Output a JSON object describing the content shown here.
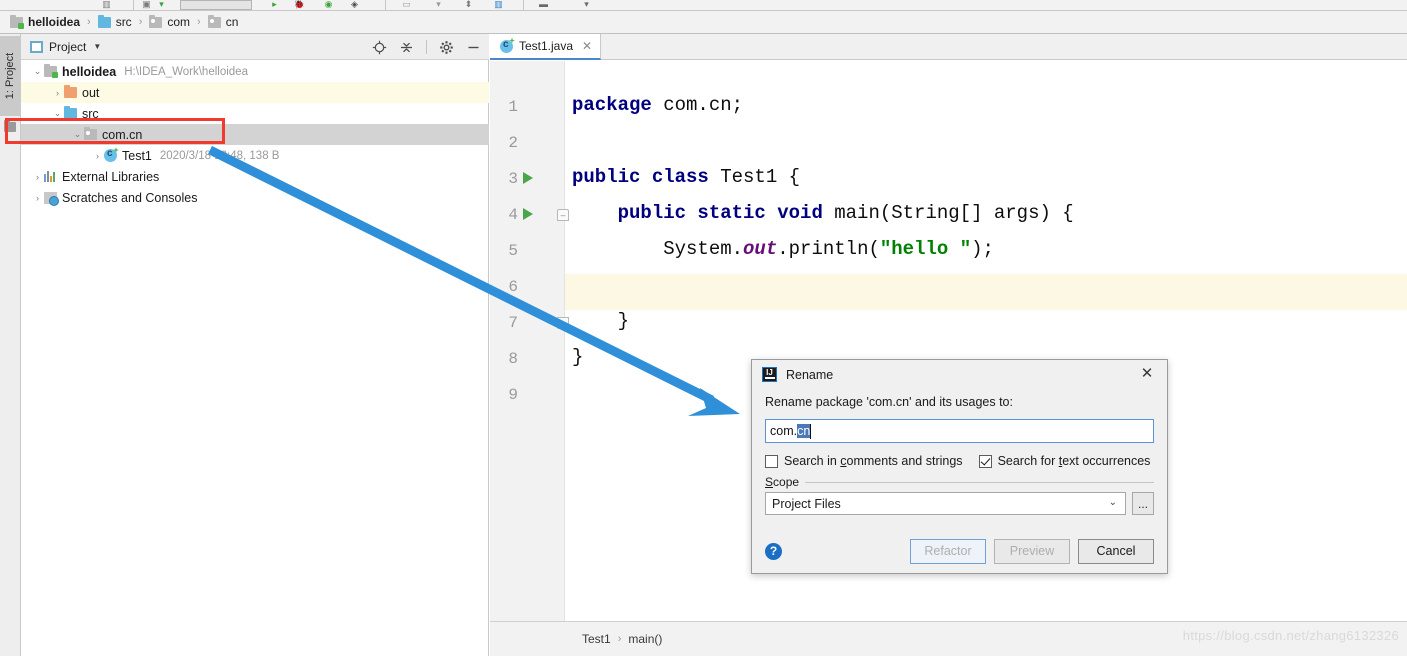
{
  "toolbar": {
    "icons": [
      "chart-icon",
      "build-icon",
      "run-config-box",
      "run-icon",
      "debug-icon",
      "coverage-icon",
      "profile-icon",
      "search-box-icon",
      "filter-icon",
      "pin-icon",
      "layout-icon",
      "minus-icon",
      "dropdown-icon"
    ]
  },
  "breadcrumb": {
    "items": [
      {
        "label": "helloidea",
        "icon": "module-folder-icon",
        "bold": true
      },
      {
        "label": "src",
        "icon": "source-folder-icon",
        "bold": false
      },
      {
        "label": "com",
        "icon": "package-folder-icon",
        "bold": false
      },
      {
        "label": "cn",
        "icon": "package-folder-icon",
        "bold": false
      }
    ],
    "separator": "›"
  },
  "tool_window_tab": {
    "label": "1: Project"
  },
  "project_panel": {
    "title": "Project",
    "dropdown_caret": "▼",
    "actions": [
      "locate-icon",
      "collapse-all-icon",
      "settings-gear-icon",
      "hide-icon"
    ],
    "tree": [
      {
        "label": "helloidea",
        "meta": "H:\\IDEA_Work\\helloidea",
        "arrow": "⌄",
        "icon": "module-folder-icon",
        "indent": 10,
        "bold": true,
        "highlight": "none"
      },
      {
        "label": "out",
        "meta": "",
        "arrow": "›",
        "icon": "out-folder-icon",
        "indent": 30,
        "bold": false,
        "highlight": "yellow"
      },
      {
        "label": "src",
        "meta": "",
        "arrow": "⌄",
        "icon": "source-folder-icon",
        "indent": 30,
        "bold": false,
        "highlight": "none"
      },
      {
        "label": "com.cn",
        "meta": "",
        "arrow": "⌄",
        "icon": "package-folder-icon",
        "indent": 50,
        "bold": false,
        "highlight": "selected"
      },
      {
        "label": "Test1",
        "meta": "2020/3/18 12:48, 138 B",
        "arrow": "›",
        "icon": "java-class-icon",
        "indent": 70,
        "bold": false,
        "highlight": "none"
      },
      {
        "label": "External Libraries",
        "meta": "",
        "arrow": "›",
        "icon": "libraries-icon",
        "indent": 10,
        "bold": false,
        "highlight": "none"
      },
      {
        "label": "Scratches and Consoles",
        "meta": "",
        "arrow": "›",
        "icon": "scratches-icon",
        "indent": 10,
        "bold": false,
        "highlight": "none"
      }
    ]
  },
  "editor": {
    "tab": {
      "label": "Test1.java",
      "icon": "java-class-icon",
      "close": "✕"
    },
    "line_numbers": [
      "1",
      "2",
      "3",
      "4",
      "5",
      "6",
      "7",
      "8",
      "9"
    ],
    "caret_line": 6,
    "run_gutter_lines": [
      3,
      4
    ],
    "fold_lines": [
      4,
      7
    ],
    "code_lines": [
      {
        "n": 1,
        "tokens": [
          {
            "t": "package",
            "c": "kw"
          },
          {
            "t": " com.cn;",
            "c": ""
          }
        ]
      },
      {
        "n": 2,
        "tokens": []
      },
      {
        "n": 3,
        "tokens": [
          {
            "t": "public class",
            "c": "kw"
          },
          {
            "t": " Test1 {",
            "c": ""
          }
        ]
      },
      {
        "n": 4,
        "tokens": [
          {
            "t": "    ",
            "c": ""
          },
          {
            "t": "public static void",
            "c": "kw"
          },
          {
            "t": " main(String[] args) {",
            "c": ""
          }
        ]
      },
      {
        "n": 5,
        "tokens": [
          {
            "t": "        System.",
            "c": ""
          },
          {
            "t": "out",
            "c": "fld"
          },
          {
            "t": ".println(",
            "c": ""
          },
          {
            "t": "\"hello \"",
            "c": "str"
          },
          {
            "t": ");",
            "c": ""
          }
        ]
      },
      {
        "n": 6,
        "tokens": []
      },
      {
        "n": 7,
        "tokens": [
          {
            "t": "    }",
            "c": ""
          }
        ]
      },
      {
        "n": 8,
        "tokens": [
          {
            "t": "}",
            "c": ""
          }
        ]
      },
      {
        "n": 9,
        "tokens": []
      }
    ]
  },
  "navbar": {
    "items": [
      "Test1",
      "main()"
    ],
    "separator": "›"
  },
  "watermark": "https://blog.csdn.net/zhang6132326",
  "annotation": {
    "rect_color": "#ef3a2d",
    "arrow_color": "#2f8fd8"
  },
  "dialog": {
    "title": "Rename",
    "app_icon": "IJ",
    "close": "✕",
    "prompt": "Rename package 'com.cn' and its usages to:",
    "input": {
      "prefix": "com.",
      "selected": "cn",
      "full_value": "com.cn"
    },
    "checkboxes": [
      {
        "label_pre": "Search in ",
        "label_mnemonic": "c",
        "label_post": "omments and strings",
        "checked": false
      },
      {
        "label_pre": "Search for ",
        "label_mnemonic": "t",
        "label_post": "ext occurrences",
        "checked": true
      }
    ],
    "scope": {
      "legend_pre": "S",
      "legend_mnemonic": "S",
      "legend": "cope",
      "value": "Project Files",
      "arrow": "⌄",
      "browse": "..."
    },
    "help": "?",
    "buttons": [
      {
        "label": "Refactor",
        "state": "disabled-focused"
      },
      {
        "label": "Preview",
        "state": "disabled"
      },
      {
        "label": "Cancel",
        "state": "enabled"
      }
    ]
  }
}
